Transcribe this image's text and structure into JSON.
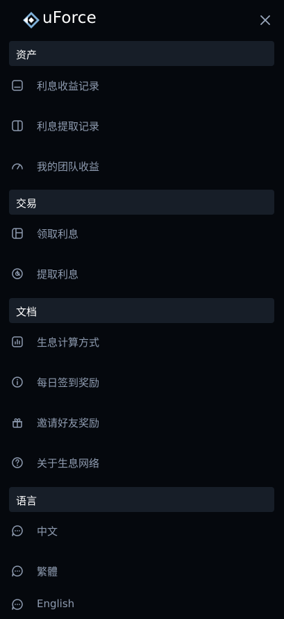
{
  "header": {
    "brand": "uForce",
    "logo_icon": "diamond-logo-icon",
    "close_icon": "close-icon"
  },
  "sections": [
    {
      "title": "资产",
      "items": [
        {
          "label": "利息收益记录",
          "icon": "wallet-icon"
        },
        {
          "label": "利息提取记录",
          "icon": "panel-icon"
        },
        {
          "label": "我的团队收益",
          "icon": "gauge-icon"
        }
      ]
    },
    {
      "title": "交易",
      "items": [
        {
          "label": "领取利息",
          "icon": "layout-icon"
        },
        {
          "label": "提取利息",
          "icon": "pie-icon"
        }
      ]
    },
    {
      "title": "文档",
      "items": [
        {
          "label": "生息计算方式",
          "icon": "bar-chart-icon"
        },
        {
          "label": "每日签到奖励",
          "icon": "info-icon"
        },
        {
          "label": "邀请好友奖励",
          "icon": "gift-icon"
        },
        {
          "label": "关于生息网络",
          "icon": "question-icon"
        }
      ]
    },
    {
      "title": "语言",
      "items": [
        {
          "label": "中文",
          "icon": "chat-icon"
        },
        {
          "label": "繁體",
          "icon": "chat-icon"
        },
        {
          "label": "English",
          "icon": "chat-icon"
        }
      ]
    }
  ],
  "colors": {
    "background": "#05080d",
    "section_bg": "#171e28",
    "text": "#8e9bb0",
    "heading": "#ffffff"
  }
}
